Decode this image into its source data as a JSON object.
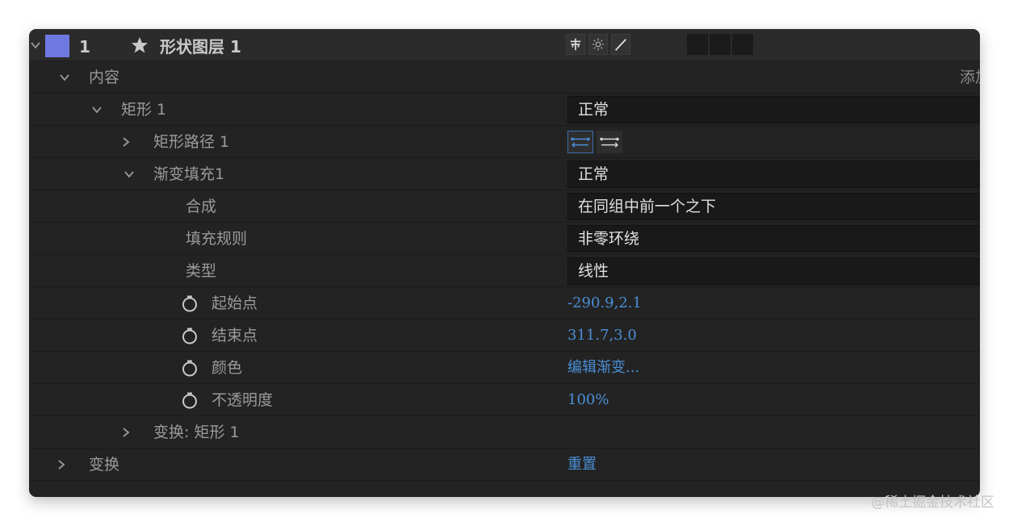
{
  "layer": {
    "number": "1",
    "name": "形状图层 1",
    "color": "#6f78e0",
    "switch_icons": [
      "puppet-icon",
      "sun-icon",
      "slash-icon"
    ]
  },
  "rows": {
    "contents": {
      "label": "内容",
      "add_label": "添加"
    },
    "rectangle": {
      "label": "矩形 1",
      "blend_value": "正常"
    },
    "rect_path": {
      "label": "矩形路径 1"
    },
    "gradient_fill": {
      "label": "渐变填充1",
      "blend_value": "正常"
    },
    "composite": {
      "label": "合成",
      "value": "在同组中前一个之下"
    },
    "fill_rule": {
      "label": "填充规则",
      "value": "非零环绕"
    },
    "type": {
      "label": "类型",
      "value": "线性"
    },
    "start_point": {
      "label": "起始点",
      "value": "-290.9,2.1"
    },
    "end_point": {
      "label": "结束点",
      "value": "311.7,3.0"
    },
    "color": {
      "label": "颜色",
      "value": "编辑渐变..."
    },
    "opacity": {
      "label": "不透明度",
      "value": "100%"
    },
    "transform_rect": {
      "label": "变换: 矩形 1"
    },
    "transform": {
      "label": "变换",
      "value": "重置"
    }
  },
  "watermark": "@稀土掘金技术社区",
  "colors": {
    "link": "#4a8fd6",
    "panel": "#232323",
    "layer_swatch": "#6f78e0"
  }
}
